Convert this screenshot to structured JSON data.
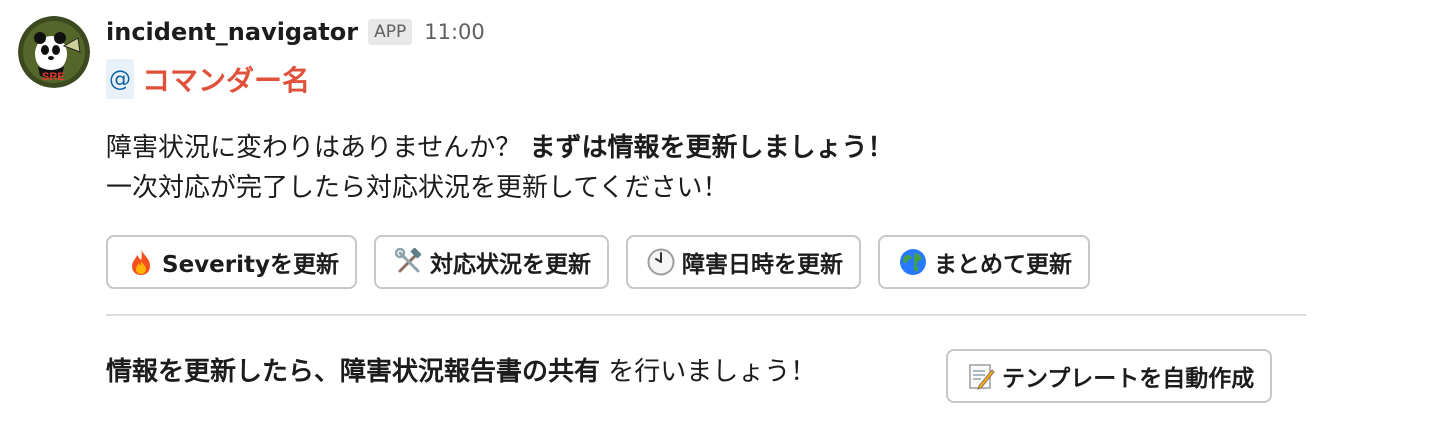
{
  "message": {
    "sender": "incident_navigator",
    "badge": "APP",
    "timestamp": "11:00",
    "mention_at": "@",
    "mention_name": "コマンダー名",
    "line1_normal": "障害状況に変わりはありませんか？ ",
    "line1_bold": "まずは情報を更新しましょう！",
    "line2": "一次対応が完了したら対応状況を更新してください！"
  },
  "buttons": [
    {
      "label": "Severityを更新",
      "icon": "fire-icon"
    },
    {
      "label": "対応状況を更新",
      "icon": "hammer-wrench-icon"
    },
    {
      "label": "障害日時を更新",
      "icon": "clock-icon"
    },
    {
      "label": "まとめて更新",
      "icon": "globe-icon"
    }
  ],
  "footer": {
    "bold": "情報を更新したら、障害状況報告書の共有",
    "normal": " を行いましょう！",
    "template_button": {
      "label": "テンプレートを自動作成",
      "icon": "memo-icon"
    }
  }
}
